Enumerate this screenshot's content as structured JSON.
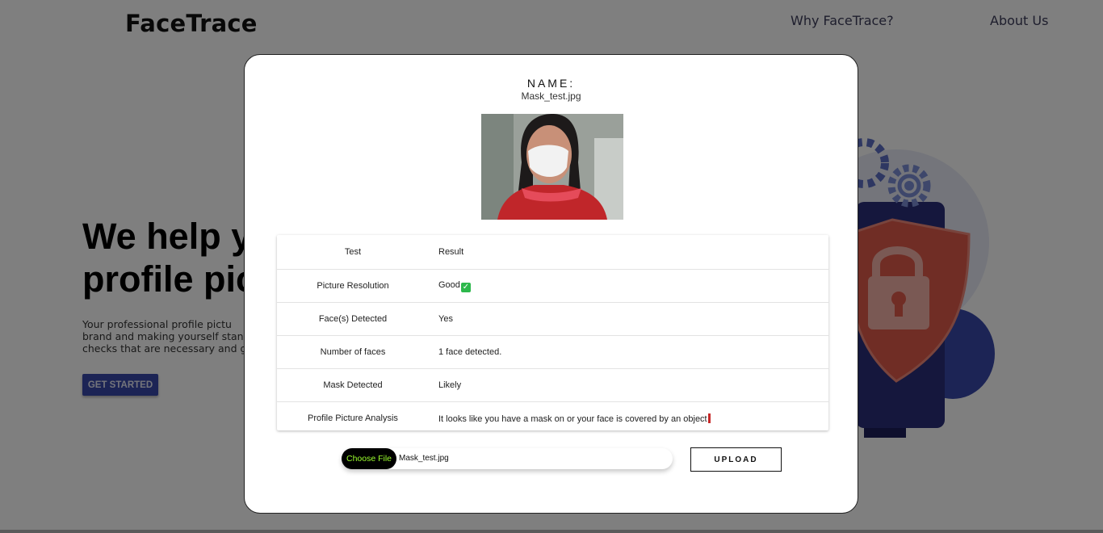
{
  "navbar": {
    "brand": "FaceTrace",
    "links": [
      "Why FaceTrace?",
      "About Us"
    ]
  },
  "hero": {
    "title": "We help yo\nprofile pic",
    "text": "  Your professional profile pictu\nbrand and making yourself stan\nchecks that are necessary and giv",
    "cta_label": "GET STARTED"
  },
  "modal": {
    "name_label": "NAME:",
    "name_value": "Mask_test.jpg",
    "image_icon": "photo-of-person-wearing-face-mask",
    "table": {
      "headers": [
        "Test",
        "Result"
      ],
      "rows": [
        {
          "test": "Picture Resolution",
          "result": "Good",
          "badge": "check-mark"
        },
        {
          "test": "Face(s) Detected",
          "result": "Yes"
        },
        {
          "test": "Number of faces",
          "result": "1 face detected."
        },
        {
          "test": "Mask Detected",
          "result": "Likely"
        },
        {
          "test": "Profile Picture Analysis",
          "result": "It looks like you have a mask on or your face is covered by an object",
          "badge": "red-mark"
        }
      ]
    },
    "file_input": {
      "button_label": "Choose File",
      "file_name": "Mask_test.jpg"
    },
    "upload_label": "UPLOAD"
  },
  "colors": {
    "overlay": "rgba(0,0,0,0.5)",
    "cta": "#3949ab",
    "choose_file_text": "#9cff2e",
    "check_badge": "#2db84c",
    "shield": "#e05a4a"
  }
}
